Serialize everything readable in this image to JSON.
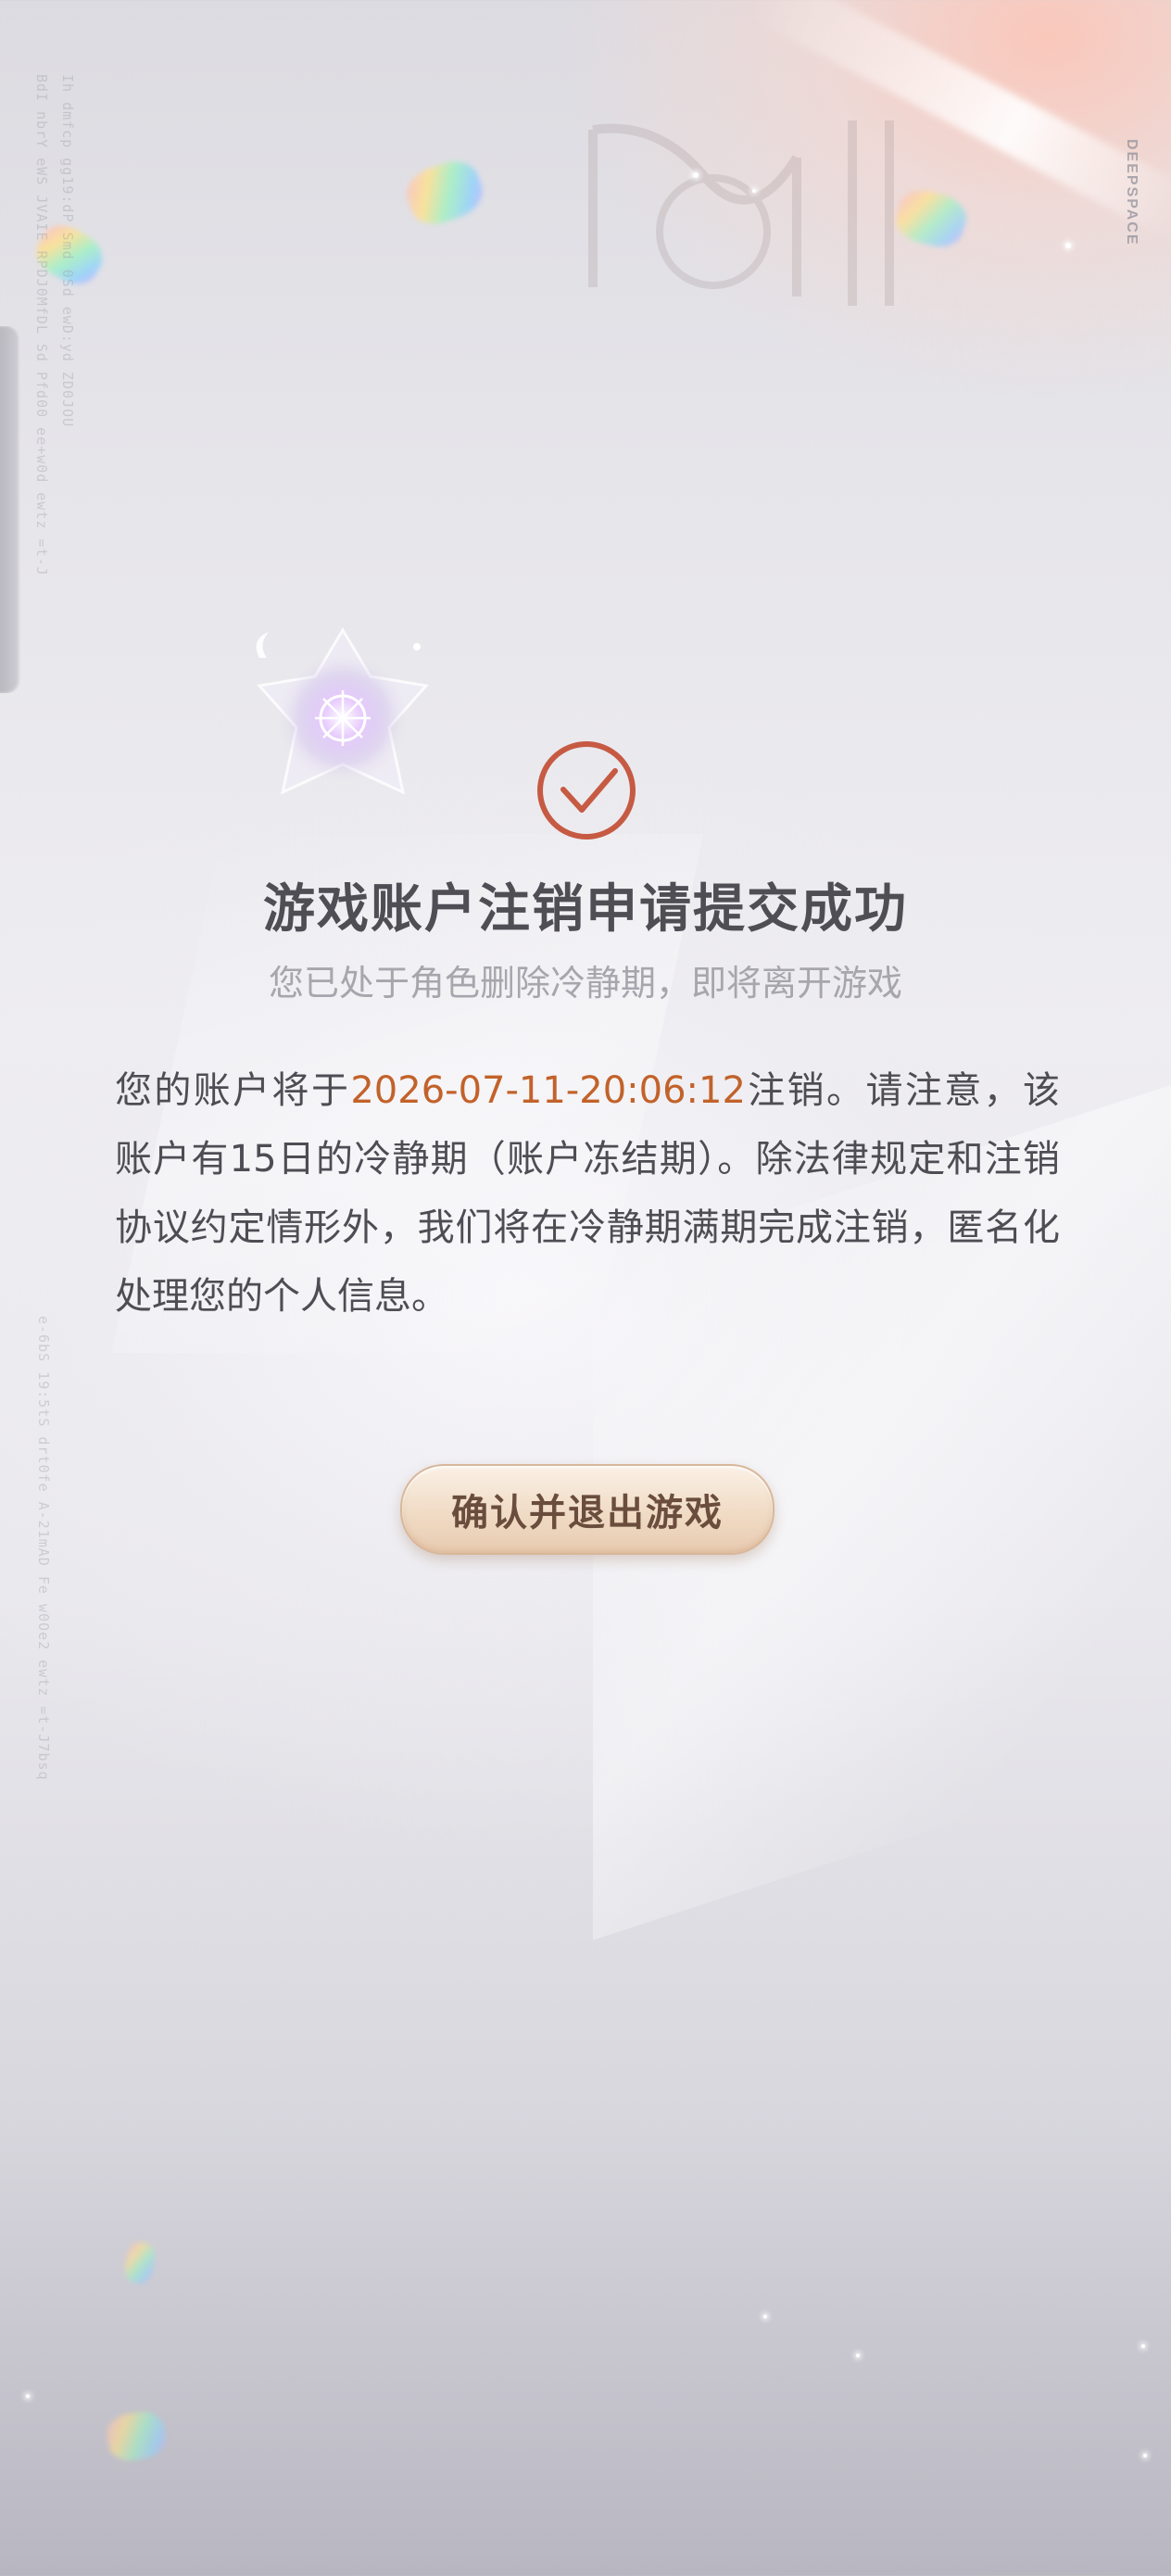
{
  "dialog": {
    "title": "游戏账户注销申请提交成功",
    "subtitle": "您已处于角色删除冷静期，即将离开游戏",
    "notice": {
      "prefix": "您的账户将于",
      "date": "2026-07-11-20:06:12",
      "suffix": "注销。请注意，该账户有15日的冷静期（账户冻结期）。除法律规定和注销协议约定情形外，我们将在冷静期满期完成注销，匿名化处理您的个人信息。"
    },
    "confirm_button_label": "确认并退出游戏"
  },
  "brand": {
    "vertical_text": "DEEPSPACE"
  },
  "icons": {
    "success": "check-circle-icon",
    "emblem": "crystal-wheel-emblem"
  },
  "colors": {
    "accent_date": "#c2622a",
    "success_ring": "#c65a43",
    "title": "#4f4e55",
    "subtitle": "#a7a6ad",
    "button_gradient_top": "#fbf1e6",
    "button_gradient_bottom": "#e8cbb0",
    "button_text": "#6a4d3c"
  }
}
